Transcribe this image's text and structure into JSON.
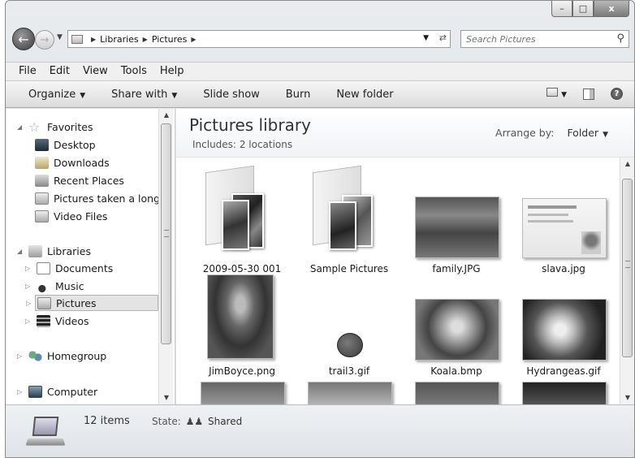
{
  "window": {
    "caption": {
      "minimize": "–",
      "maximize": "□",
      "close": "x"
    }
  },
  "address": {
    "crumbs": [
      "Libraries",
      "Pictures"
    ],
    "search_placeholder": "Search Pictures"
  },
  "menu": [
    "File",
    "Edit",
    "View",
    "Tools",
    "Help"
  ],
  "commands": {
    "organize": "Organize",
    "share_with": "Share with",
    "slide_show": "Slide show",
    "burn": "Burn",
    "new_folder": "New folder"
  },
  "nav": {
    "favorites": "Favorites",
    "fav_items": [
      "Desktop",
      "Downloads",
      "Recent Places",
      "Pictures taken a long",
      "Video Files"
    ],
    "libraries": "Libraries",
    "lib_items": [
      "Documents",
      "Music",
      "Pictures",
      "Videos"
    ],
    "homegroup": "Homegroup",
    "computer": "Computer"
  },
  "library": {
    "title": "Pictures library",
    "includes_label": "Includes:",
    "includes_link": "2 locations",
    "arrange_label": "Arrange by:",
    "arrange_value": "Folder"
  },
  "files": [
    {
      "name": "2009-05-30 001",
      "kind": "folder"
    },
    {
      "name": "Sample Pictures",
      "kind": "folder"
    },
    {
      "name": "family.JPG",
      "kind": "image"
    },
    {
      "name": "slava.jpg",
      "kind": "image"
    },
    {
      "name": "JimBoyce.png",
      "kind": "image"
    },
    {
      "name": "trail3.gif",
      "kind": "image"
    },
    {
      "name": "Koala.bmp",
      "kind": "image"
    },
    {
      "name": "Hydrangeas.gif",
      "kind": "image"
    }
  ],
  "details": {
    "count": "12 items",
    "state_label": "State:",
    "state_value": "Shared"
  },
  "icons": {
    "back": "arrow-left-icon",
    "forward": "arrow-right-icon",
    "search": "search-icon",
    "help": "help-icon"
  }
}
